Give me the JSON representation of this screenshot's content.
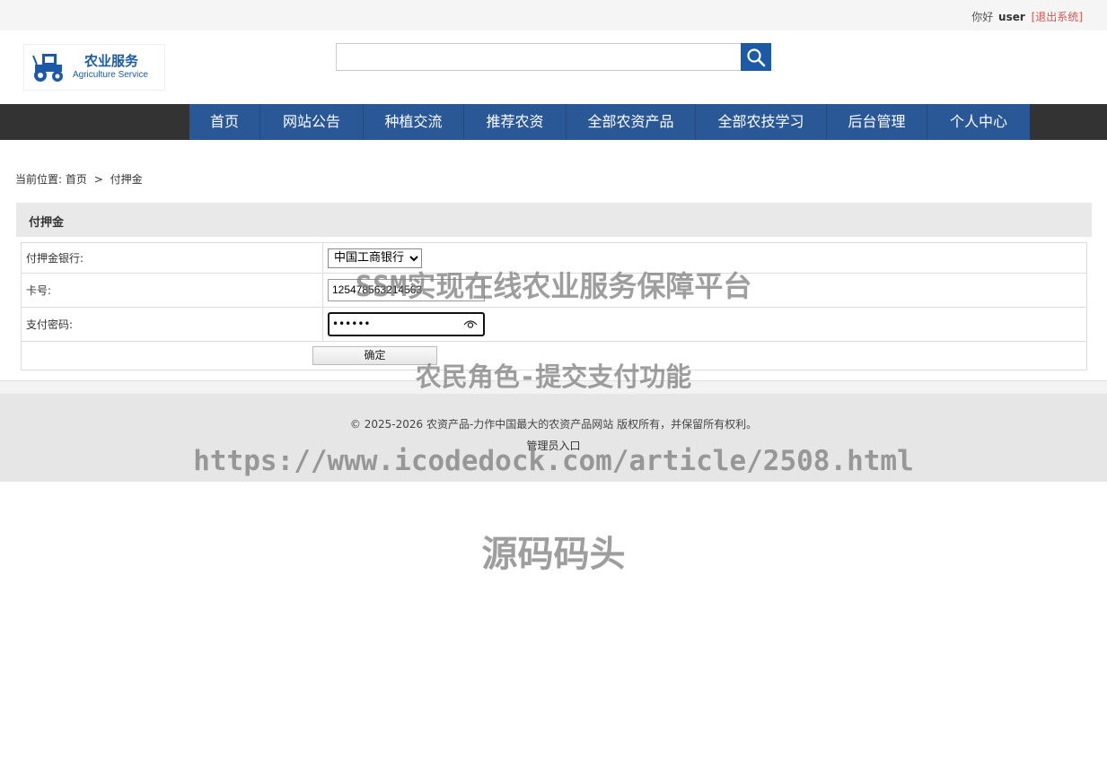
{
  "topbar": {
    "greeting": "你好",
    "username": "user",
    "logout_label": "[退出系统]"
  },
  "logo": {
    "title": "农业服务",
    "subtitle": "Agriculture Service",
    "icon": "tractor-icon"
  },
  "search": {
    "placeholder": "",
    "button_icon": "search-icon"
  },
  "nav": {
    "items": [
      {
        "label": "首页"
      },
      {
        "label": "网站公告"
      },
      {
        "label": "种植交流"
      },
      {
        "label": "推荐农资"
      },
      {
        "label": "全部农资产品"
      },
      {
        "label": "全部农技学习"
      },
      {
        "label": "后台管理"
      },
      {
        "label": "个人中心"
      }
    ]
  },
  "breadcrumb": {
    "prefix": "当前位置:",
    "home": "首页",
    "sep": ">",
    "current": "付押金"
  },
  "panel": {
    "title": "付押金"
  },
  "form": {
    "bank_label": "付押金银行:",
    "bank_value": "中国工商银行",
    "card_label": "卡号:",
    "card_value": "125478563214563",
    "pwd_label": "支付密码:",
    "pwd_value": "••••••",
    "submit_label": "确定"
  },
  "footer": {
    "copyright": "© 2025-2026 农资产品-力作中国最大的农资产品网站 版权所有，并保留所有权利。",
    "admin_link": "管理员入口"
  },
  "watermarks": {
    "line1": "SSM实现在线农业服务保障平台",
    "line2": "农民角色-提交支付功能",
    "line3": "https://www.icodedock.com/article/2508.html",
    "line4": "源码码头"
  },
  "colors": {
    "brand": "#1c5aa8",
    "nav": "#2a5796",
    "navbar_bg": "#333333",
    "logout": "#d9534f"
  }
}
